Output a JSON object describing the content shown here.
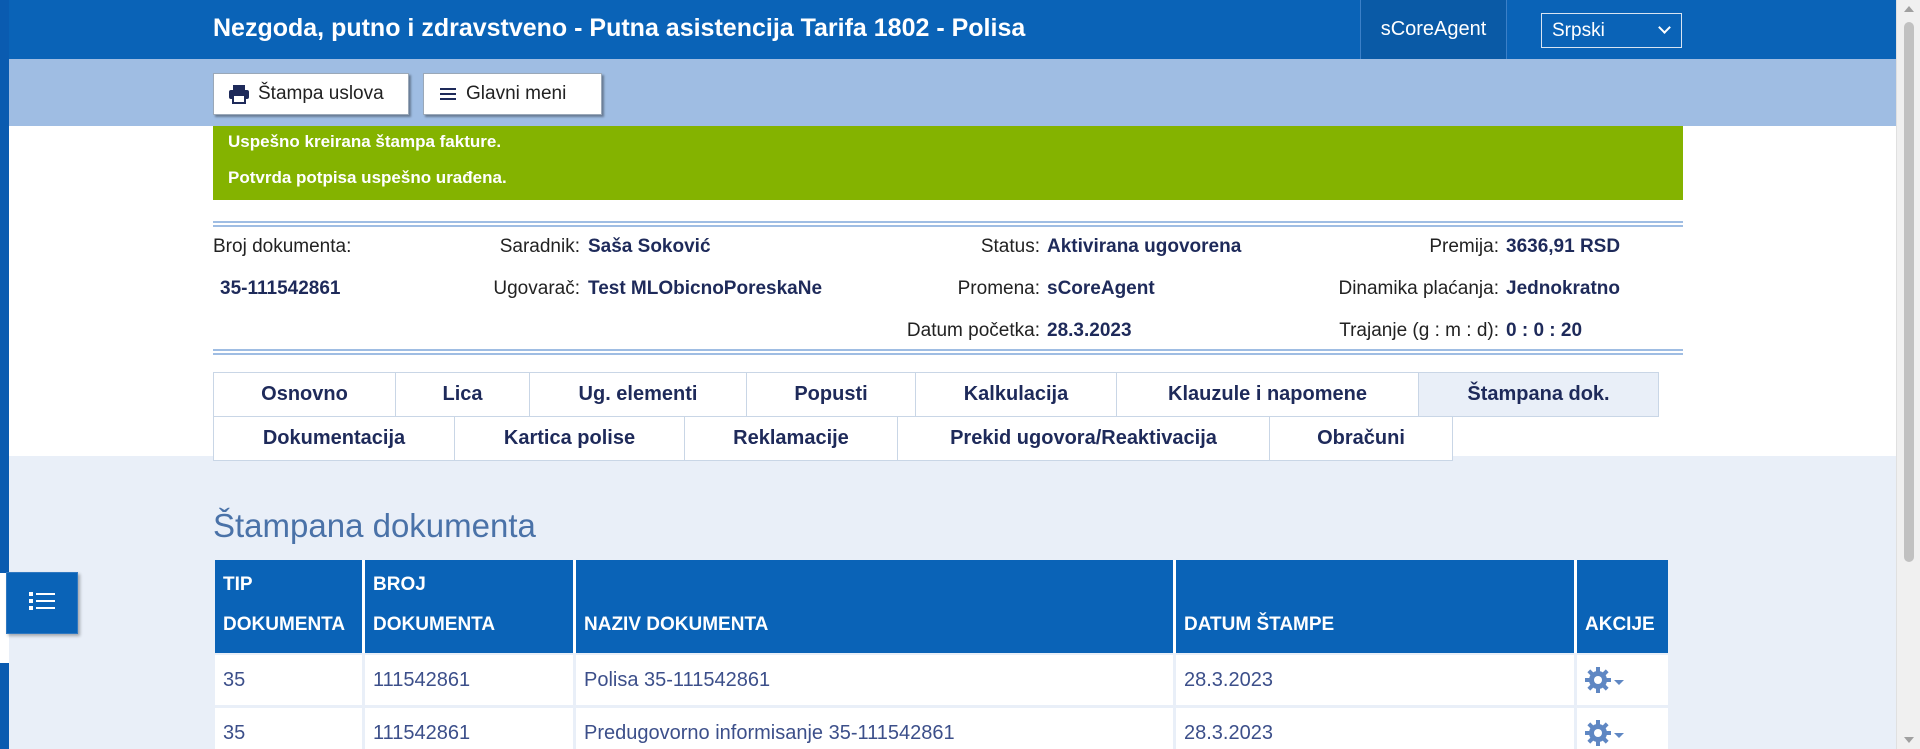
{
  "header": {
    "title": "Nezgoda, putno i zdravstveno - Putna asistencija Tarifa 1802 - Polisa",
    "agent": "sCoreAgent",
    "language": "Srpski"
  },
  "toolbar": {
    "print_label": "Štampa uslova",
    "menu_label": "Glavni meni"
  },
  "messages": [
    "Uspešno kreirana štampa fakture.",
    "Potvrda potpisa uspešno urađena."
  ],
  "info": {
    "doc_number_label": "Broj dokumenta:",
    "doc_number_value": "35-111542861",
    "associate_label": "Saradnik:",
    "associate_value": "Saša Soković",
    "contractor_label": "Ugovarač:",
    "contractor_value": "Test MLObicnoPoreskaNe",
    "status_label": "Status:",
    "status_value": "Aktivirana ugovorena",
    "change_label": "Promena:",
    "change_value": "sCoreAgent",
    "start_label": "Datum početka:",
    "start_value": "28.3.2023",
    "premium_label": "Premija:",
    "premium_value": "3636,91 RSD",
    "payment_label": "Dinamika plaćanja:",
    "payment_value": "Jednokratno",
    "duration_label": "Trajanje (g : m : d):",
    "duration_value": "0 : 0 : 20"
  },
  "tabs_row1": [
    "Osnovno",
    "Lica",
    "Ug. elementi",
    "Popusti",
    "Kalkulacija",
    "Klauzule i napomene",
    "Štampana dok."
  ],
  "tabs_row2": [
    "Dokumentacija",
    "Kartica polise",
    "Reklamacije",
    "Prekid ugovora/Reaktivacija",
    "Obračuni"
  ],
  "active_tab": "Štampana dok.",
  "section_title": "Štampana dokumenta",
  "table": {
    "headers": {
      "type_1": "TIP",
      "type_2": "DOKUMENTA",
      "number_1": "BROJ",
      "number_2": "DOKUMENTA",
      "name": "NAZIV DOKUMENTA",
      "date": "DATUM ŠTAMPE",
      "actions": "AKCIJE"
    },
    "rows": [
      {
        "type": "35",
        "number": "111542861",
        "name": "Polisa 35-111542861",
        "date": "28.3.2023"
      },
      {
        "type": "35",
        "number": "111542861",
        "name": "Predugovorno informisanje 35-111542861",
        "date": "28.3.2023"
      }
    ]
  },
  "colors": {
    "primary": "#0a63b7",
    "toolbar": "#9fbde3",
    "success": "#84b300",
    "label_text": "#1e2a5a"
  },
  "icons": {
    "print": "printer-icon",
    "menu": "hamburger-icon",
    "side": "list-icon",
    "actions": "gear-icon"
  }
}
